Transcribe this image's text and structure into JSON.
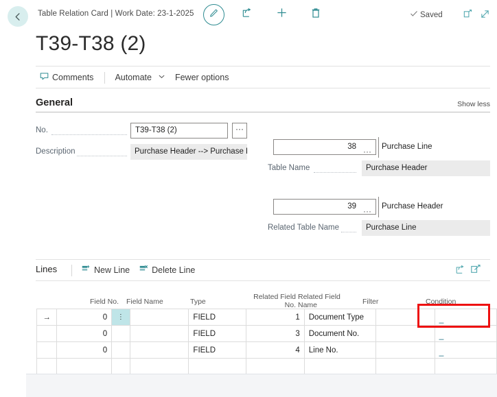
{
  "topbar": {
    "back_icon": "arrow-left-icon",
    "breadcrumb": "Table Relation Card | Work Date: 23-1-2025",
    "edit_icon": "pencil-icon",
    "share_icon": "share-icon",
    "add_icon": "plus-icon",
    "delete_icon": "trash-icon",
    "saved_label": "Saved",
    "saved_icon": "check-icon",
    "popout_icon": "open-in-new-window-icon",
    "expand_icon": "expand-diagonal-icon"
  },
  "page": {
    "title": "T39-T38 (2)"
  },
  "actions": {
    "comments": "Comments",
    "comments_icon": "comment-bubble-icon",
    "automate": "Automate",
    "automate_chevron": "chevron-down-icon",
    "fewer_options": "Fewer options"
  },
  "general": {
    "heading": "General",
    "show_less": "Show less",
    "fields": {
      "no_label": "No.",
      "no_value": "T39-T38 (2)",
      "no_lookup": "···",
      "description_label": "Description",
      "description_value": "Purchase Header --> Purchase L...",
      "table_no_value": "38",
      "table_no_lookup": "···",
      "table_no_side": "Purchase Line",
      "table_name_label": "Table Name",
      "table_name_value": "Purchase Header",
      "related_table_no_value": "39",
      "related_table_no_lookup": "···",
      "related_table_no_side": "Purchase Header",
      "related_table_name_label": "Related Table Name",
      "related_table_name_value": "Purchase Line"
    }
  },
  "lines": {
    "heading": "Lines",
    "new_line": "New Line",
    "new_line_icon": "new-line-icon",
    "delete_line": "Delete Line",
    "delete_line_icon": "delete-line-icon",
    "share_icon": "share-icon",
    "edit_grid_icon": "edit-in-excel-icon",
    "columns": [
      "Field No.",
      "Field Name",
      "Type",
      "Related Field No.",
      "Related Field Name",
      "Filter",
      "Condition"
    ],
    "column_headers_display": {
      "field_no": "Field No.",
      "field_name": "Field Name",
      "type": "Type",
      "related_field_no_l1": "Related Field",
      "related_field_no_l2": "No.",
      "related_field_name_l1": "Related Field",
      "related_field_name_l2": "Name",
      "filter": "Filter",
      "condition": "Condition"
    },
    "rows": [
      {
        "selected": true,
        "arrow": "→",
        "field_no": "0",
        "row_menu_icon": "vertical-dots-icon",
        "field_name": "",
        "type": "FIELD",
        "related_field_no": "1",
        "related_field_name": "Document Type",
        "filter": "",
        "condition": "_"
      },
      {
        "selected": false,
        "arrow": "",
        "field_no": "0",
        "row_menu_icon": "",
        "field_name": "",
        "type": "FIELD",
        "related_field_no": "3",
        "related_field_name": "Document No.",
        "filter": "",
        "condition": "_"
      },
      {
        "selected": false,
        "arrow": "",
        "field_no": "0",
        "row_menu_icon": "",
        "field_name": "",
        "type": "FIELD",
        "related_field_no": "4",
        "related_field_name": "Line No.",
        "filter": "",
        "condition": "_"
      },
      {
        "selected": false,
        "arrow": "",
        "field_no": "",
        "row_menu_icon": "",
        "field_name": "",
        "type": "",
        "related_field_no": "",
        "related_field_name": "",
        "filter": "",
        "condition": ""
      }
    ]
  },
  "highlight": {
    "name": "condition-cell-highlight",
    "color": "#ee1111"
  },
  "colors": {
    "accent_teal": "#2e8b91",
    "back_circle": "#d8eeee",
    "selected_cell": "#bfe5e8",
    "readonly_field": "#ebebeb",
    "highlight_red": "#ee1111"
  }
}
